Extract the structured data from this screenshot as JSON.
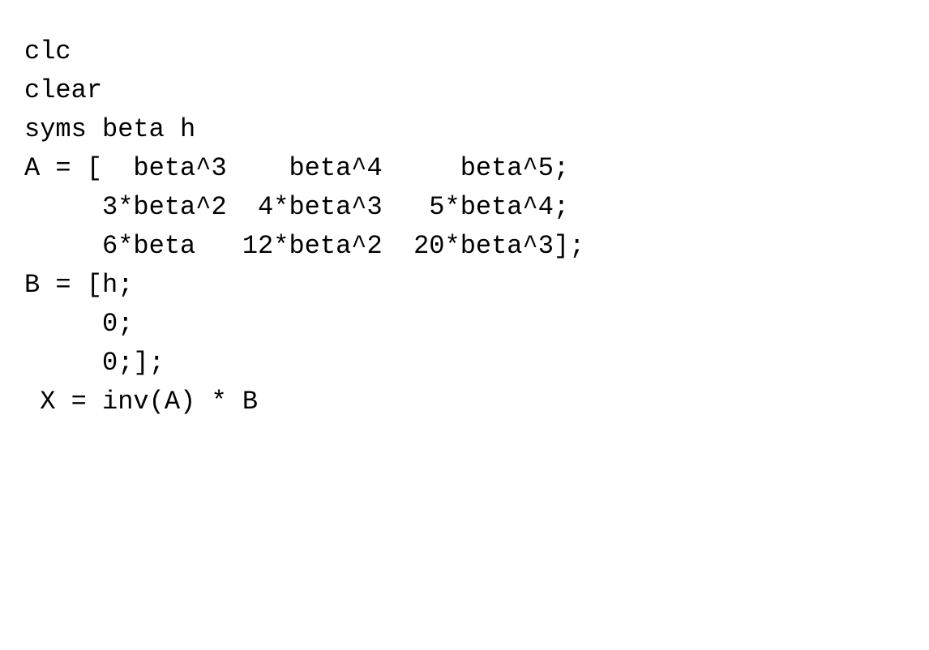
{
  "code": {
    "lines": [
      "clc",
      "clear",
      "",
      "syms beta h",
      "",
      "A = [  beta^3    beta^4     beta^5;",
      "     3*beta^2  4*beta^3   5*beta^4;",
      "     6*beta   12*beta^2  20*beta^3];",
      "",
      "B = [h;",
      "     0;",
      "     0;];",
      "",
      " X = inv(A) * B"
    ]
  }
}
